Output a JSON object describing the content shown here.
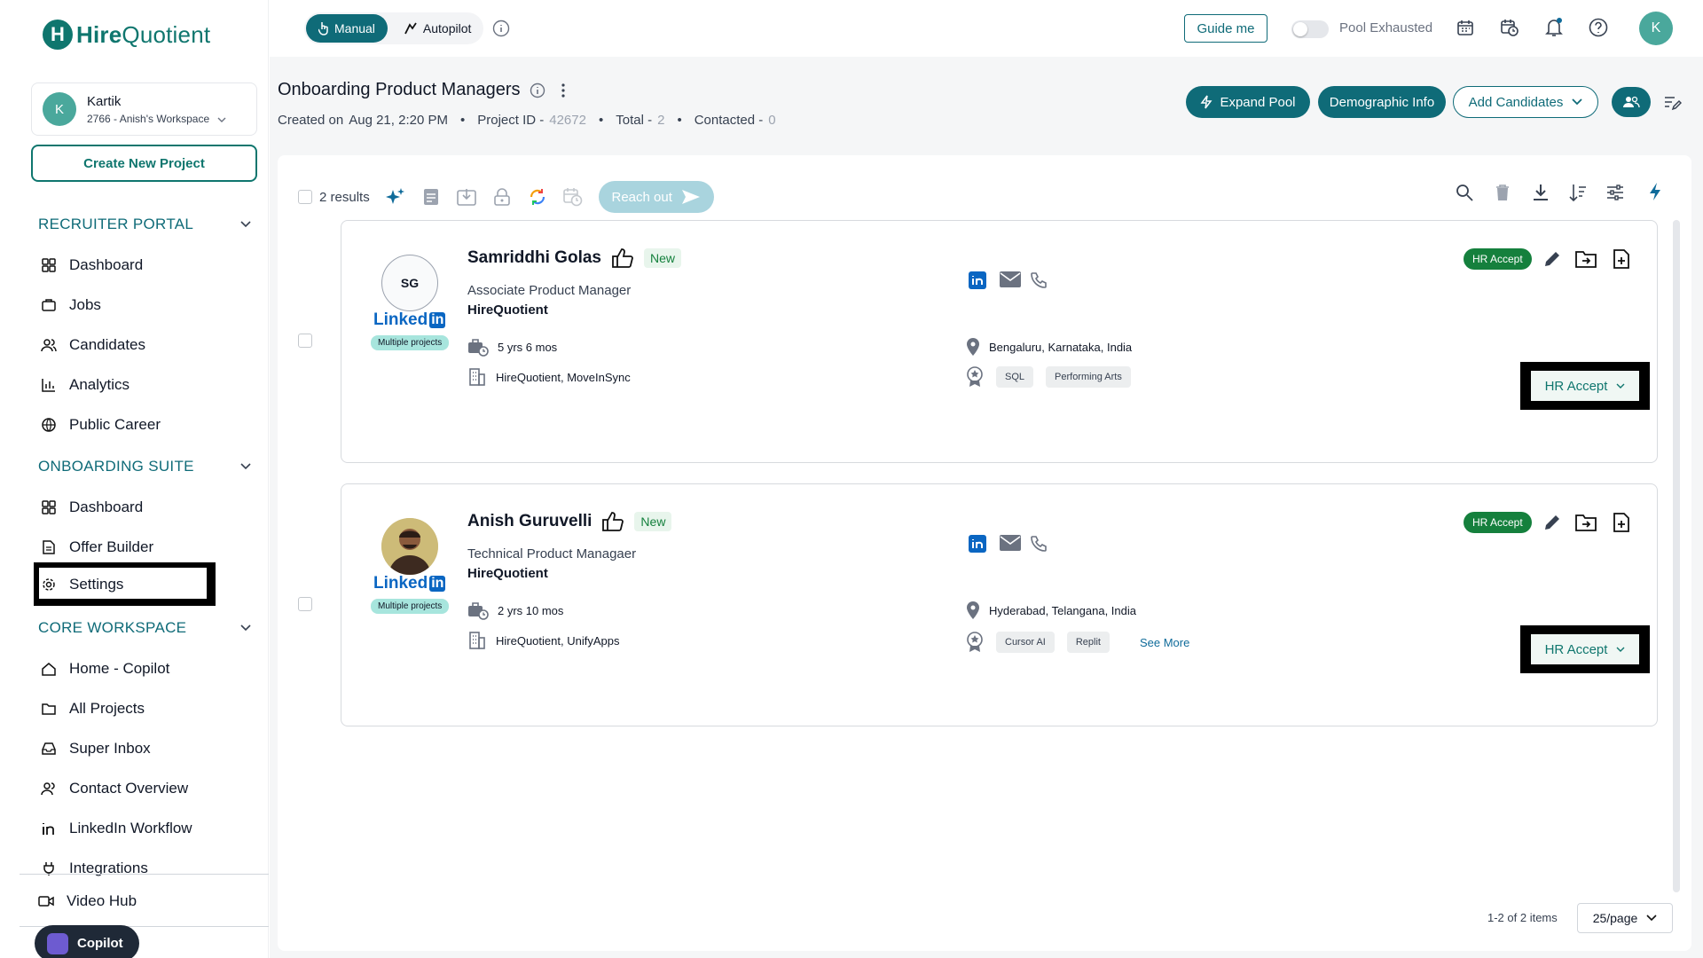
{
  "app": {
    "logo_text_bold": "Hire",
    "logo_text": "Quotient",
    "logo_mark": "H"
  },
  "workspace": {
    "avatar": "K",
    "name": "Kartik",
    "sub": "2766 - Anish's Workspace"
  },
  "sidebar": {
    "create_label": "Create New Project",
    "sections": [
      {
        "title": "RECRUITER PORTAL",
        "items": [
          "Dashboard",
          "Jobs",
          "Candidates",
          "Analytics",
          "Public Career"
        ]
      },
      {
        "title": "ONBOARDING SUITE",
        "items": [
          "Dashboard",
          "Offer Builder",
          "Settings"
        ]
      },
      {
        "title": "CORE WORKSPACE",
        "items": [
          "Home - Copilot",
          "All Projects",
          "Super Inbox",
          "Contact Overview",
          "LinkedIn Workflow",
          "Integrations"
        ]
      }
    ],
    "video_hub": "Video Hub",
    "copilot": "Copilot"
  },
  "topbar": {
    "manual": "Manual",
    "autopilot": "Autopilot",
    "guide": "Guide me",
    "pool": "Pool Exhausted",
    "user_avatar": "K"
  },
  "project": {
    "title": "Onboarding Product Managers",
    "created_label": "Created on",
    "created_value": "Aug 21, 2:20 PM",
    "id_label": "Project ID -",
    "id_value": "42672",
    "total_label": "Total -",
    "total_value": "2",
    "contacted_label": "Contacted -",
    "contacted_value": "0",
    "expand_pool": "Expand Pool",
    "demographic": "Demographic Info",
    "add_candidates": "Add Candidates"
  },
  "toolbar": {
    "results": "2 results",
    "reach_out": "Reach out"
  },
  "candidates": [
    {
      "initials": "SG",
      "linkedin": "Linked",
      "linkedin_box": "in",
      "multi": "Multiple projects",
      "name": "Samriddhi Golas",
      "badge": "New",
      "role": "Associate Product Manager",
      "company": "HireQuotient",
      "experience": "5 yrs 6 mos",
      "companies": "HireQuotient, MoveInSync",
      "location": "Bengaluru, Karnataka, India",
      "skills": [
        "SQL",
        "Performing Arts"
      ],
      "see_more": "",
      "status_chip": "HR Accept",
      "status_select": "HR Accept"
    },
    {
      "initials": "",
      "linkedin": "Linked",
      "linkedin_box": "in",
      "multi": "Multiple projects",
      "name": "Anish Guruvelli",
      "badge": "New",
      "role": "Technical Product Managaer",
      "company": "HireQuotient",
      "experience": "2 yrs 10 mos",
      "companies": "HireQuotient, UnifyApps",
      "location": "Hyderabad, Telangana, India",
      "skills": [
        "Cursor AI",
        "Replit"
      ],
      "see_more": "See More",
      "status_chip": "HR Accept",
      "status_select": "HR Accept"
    }
  ],
  "pagination": {
    "range": "1-2 of 2 items",
    "per_page": "25/page"
  },
  "colors": {
    "primary": "#0f6b78",
    "accent_green": "#15803d",
    "linkedin": "#0a66c2"
  }
}
